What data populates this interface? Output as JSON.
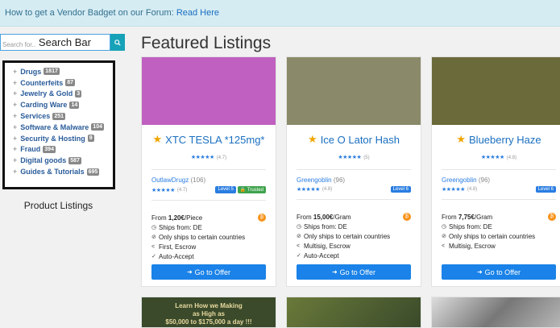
{
  "notice": {
    "text": "How to get a Vendor Badget on our Forum:",
    "link": "Read Here"
  },
  "search": {
    "placeholder": "Search for..",
    "label": "Search Bar"
  },
  "categories": [
    {
      "name": "Drugs",
      "count": "1817"
    },
    {
      "name": "Counterfeits",
      "count": "87"
    },
    {
      "name": "Jewelry & Gold",
      "count": "3"
    },
    {
      "name": "Carding Ware",
      "count": "14"
    },
    {
      "name": "Services",
      "count": "251"
    },
    {
      "name": "Software & Malware",
      "count": "104"
    },
    {
      "name": "Security & Hosting",
      "count": "9"
    },
    {
      "name": "Fraud",
      "count": "394"
    },
    {
      "name": "Digital goods",
      "count": "587"
    },
    {
      "name": "Guides & Tutorials",
      "count": "695"
    }
  ],
  "product_listings_label": "Product Listings",
  "heading": "Featured Listings",
  "listings": [
    {
      "title": "XTC TESLA *125mg*",
      "rating": "(4.7)",
      "vendor": "OutlawDrugz",
      "vendor_count": "(106)",
      "vendor_rating": "(4.7)",
      "level": "Level 5",
      "trusted": "Trusted",
      "price_prefix": "From",
      "price": "1,20€",
      "unit": "/Piece",
      "ships_from": "Ships from: DE",
      "ships_to": "Only ships to certain countries",
      "escrow": "First, Escrow",
      "auto": "Auto-Accept",
      "button": "Go to Offer",
      "image_color": "#c060c0"
    },
    {
      "title": "Ice O Lator Hash",
      "rating": "(5)",
      "vendor": "Greengoblin",
      "vendor_count": "(96)",
      "vendor_rating": "(4.8)",
      "level": "Level 6",
      "price_prefix": "From",
      "price": "15,00€",
      "unit": "/Gram",
      "ships_from": "Ships from: DE",
      "ships_to": "Only ships to certain countries",
      "escrow": "Multisig, Escrow",
      "auto": "Auto-Accept",
      "button": "Go to Offer",
      "image_color": "#8a8a6a"
    },
    {
      "title": "Blueberry Haze",
      "rating": "(4.8)",
      "vendor": "Greengoblin",
      "vendor_count": "(96)",
      "vendor_rating": "(4.8)",
      "level": "Level 6",
      "price_prefix": "From",
      "price": "7,75€",
      "unit": "/Gram",
      "ships_from": "Ships from: DE",
      "ships_to": "Only ships to certain countries",
      "escrow": "Multisig, Escrow",
      "button": "Go to Offer",
      "image_color": "#6b6a3a"
    }
  ],
  "bottom_banner": {
    "line1": "Learn How we Making",
    "line2": "as High as",
    "line3": "$50,000 to $175,000 a day !!!"
  }
}
